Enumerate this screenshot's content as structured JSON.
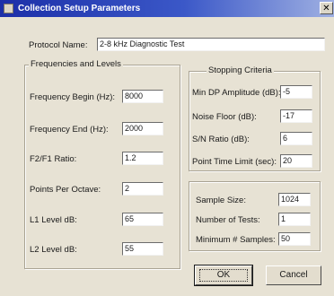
{
  "dialog": {
    "title": "Collection Setup Parameters",
    "close_glyph": "✕",
    "protocol_name": {
      "label": "Protocol Name:",
      "value": "2-8 kHz Diagnostic Test"
    }
  },
  "frequencies": {
    "group_title": "Frequencies and Levels",
    "fields": [
      {
        "label": "Frequency Begin (Hz):",
        "value": "8000"
      },
      {
        "label": "Frequency End (Hz):",
        "value": "2000"
      },
      {
        "label": "F2/F1 Ratio:",
        "value": "1.2"
      },
      {
        "label": "Points Per Octave:",
        "value": "2"
      },
      {
        "label": "L1 Level dB:",
        "value": "65"
      },
      {
        "label": "L2 Level dB:",
        "value": "55"
      }
    ]
  },
  "stopping": {
    "group_title": "Stopping Criteria",
    "fields": [
      {
        "label": "Min DP Amplitude (dB):",
        "value": "-5"
      },
      {
        "label": "Noise Floor (dB):",
        "value": "-17"
      },
      {
        "label": "S/N Ratio (dB):",
        "value": "6"
      },
      {
        "label": "Point Time Limit (sec):",
        "value": "20"
      }
    ]
  },
  "sampling": {
    "fields": [
      {
        "label": "Sample Size:",
        "value": "1024"
      },
      {
        "label": "Number of Tests:",
        "value": "1"
      },
      {
        "label": "Minimum # Samples:",
        "value": "50"
      }
    ]
  },
  "buttons": {
    "ok": "OK",
    "cancel": "Cancel"
  }
}
